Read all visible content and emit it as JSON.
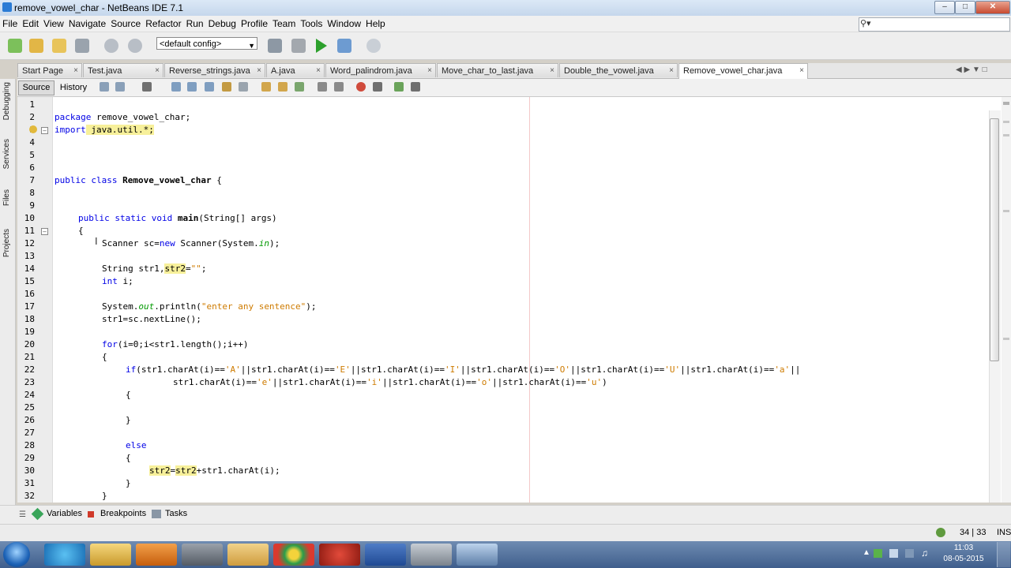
{
  "window": {
    "title": "remove_vowel_char - NetBeans IDE 7.1"
  },
  "menu": [
    "File",
    "Edit",
    "View",
    "Navigate",
    "Source",
    "Refactor",
    "Run",
    "Debug",
    "Profile",
    "Team",
    "Tools",
    "Window",
    "Help"
  ],
  "toolbar": {
    "config": "<default config>"
  },
  "tabs": [
    {
      "label": "Start Page"
    },
    {
      "label": "Test.java"
    },
    {
      "label": "Reverse_strings.java"
    },
    {
      "label": "A.java"
    },
    {
      "label": "Word_palindrom.java"
    },
    {
      "label": "Move_char_to_last.java"
    },
    {
      "label": "Double_the_vowel.java"
    },
    {
      "label": "Remove_vowel_char.java"
    }
  ],
  "sidebar": [
    "Debugging",
    "Services",
    "Files",
    "Projects"
  ],
  "editor_tabs": {
    "source": "Source",
    "history": "History"
  },
  "line_numbers": [
    "1",
    "2",
    "3",
    "4",
    "5",
    "6",
    "7",
    "8",
    "9",
    "10",
    "11",
    "12",
    "13",
    "14",
    "15",
    "16",
    "17",
    "18",
    "19",
    "20",
    "21",
    "22",
    "23",
    "24",
    "25",
    "26",
    "27",
    "28",
    "29",
    "30",
    "31",
    "32"
  ],
  "code": {
    "l2": [
      "package",
      " remove_vowel_char;"
    ],
    "l3": [
      "import",
      " java.util.*;"
    ],
    "l7": [
      "public class ",
      "Remove_vowel_char",
      " {"
    ],
    "l10": [
      "public static void ",
      "main",
      "(String[] args)"
    ],
    "l11": "{",
    "l12": [
      "Scanner sc=",
      "new",
      " Scanner(System.",
      "in",
      ");"
    ],
    "l14": [
      "String str1,",
      "str2",
      "=",
      "\"\"",
      ";"
    ],
    "l15": [
      "int",
      " i;"
    ],
    "l17": [
      "System.",
      "out",
      ".println(",
      "\"enter any sentence\"",
      ");"
    ],
    "l18": "str1=sc.nextLine();",
    "l20": [
      "for",
      "(i=0;i<str1.length();i++)"
    ],
    "l21": "{",
    "l22": [
      "if",
      "(str1.charAt(i)==",
      "'A'",
      "||str1.charAt(i)==",
      "'E'",
      "||str1.charAt(i)==",
      "'I'",
      "||str1.charAt(i)==",
      "'O'",
      "||str1.charAt(i)==",
      "'U'",
      "||str1.charAt(i)==",
      "'a'",
      "||"
    ],
    "l23": [
      "str1.charAt(i)==",
      "'e'",
      "||str1.charAt(i)==",
      "'i'",
      "||str1.charAt(i)==",
      "'o'",
      "||str1.charAt(i)==",
      "'u'",
      ")"
    ],
    "l24": "{",
    "l26": "}",
    "l28": "else",
    "l29": "{",
    "l30": [
      "str2",
      "=",
      "str2",
      "+str1.charAt(i);"
    ],
    "l31": "}",
    "l32": "}"
  },
  "bottom_panel": {
    "variables": "Variables",
    "breakpoints": "Breakpoints",
    "tasks": "Tasks"
  },
  "status": {
    "position": "34 | 33",
    "mode": "INS"
  },
  "clock": {
    "time": "11:03",
    "date": "08-05-2015"
  }
}
